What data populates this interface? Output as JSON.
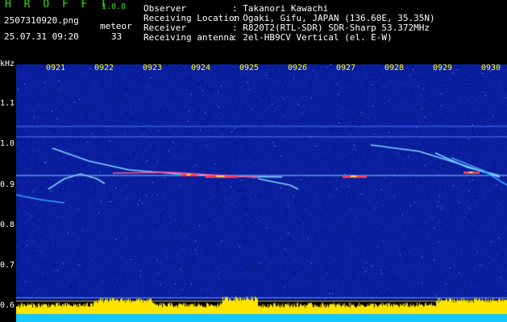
{
  "app": {
    "title": "H R O F F T",
    "version": "1.0.0"
  },
  "file": {
    "name": "2507310920.png",
    "datetime": "25.07.31 09:20"
  },
  "meteor": {
    "label": "meteor",
    "count": "33"
  },
  "station": [
    {
      "key": "Observer",
      "value": ": Takanori Kawachi"
    },
    {
      "key": "Receiving Location",
      "value": ": Ogaki, Gifu, JAPAN (136.60E, 35.35N)"
    },
    {
      "key": "Receiver",
      "value": ": R820T2(RTL-SDR) SDR-Sharp 53.372MHz"
    },
    {
      "key": "Receiving antenna",
      "value": ": 2el-HB9CV Vertical (el. E-W)"
    }
  ],
  "axis": {
    "unit": "kHz",
    "freq_ticks": [
      "1.1",
      "1.0",
      "0.9",
      "0.8",
      "0.7",
      "0.6"
    ],
    "time_ticks": [
      "0921",
      "0922",
      "0923",
      "0924",
      "0925",
      "0926",
      "0927",
      "0928",
      "0929",
      "0930"
    ]
  },
  "colors": {
    "background": "#000000",
    "noise": "#0a1ea0",
    "tick_text": "#ffff00",
    "carrier": "#7dd8ff",
    "strong_echo": "#ff3a5a",
    "audio_level_fill": "#ffe400",
    "audio_base_fill": "#14c8ff"
  }
}
